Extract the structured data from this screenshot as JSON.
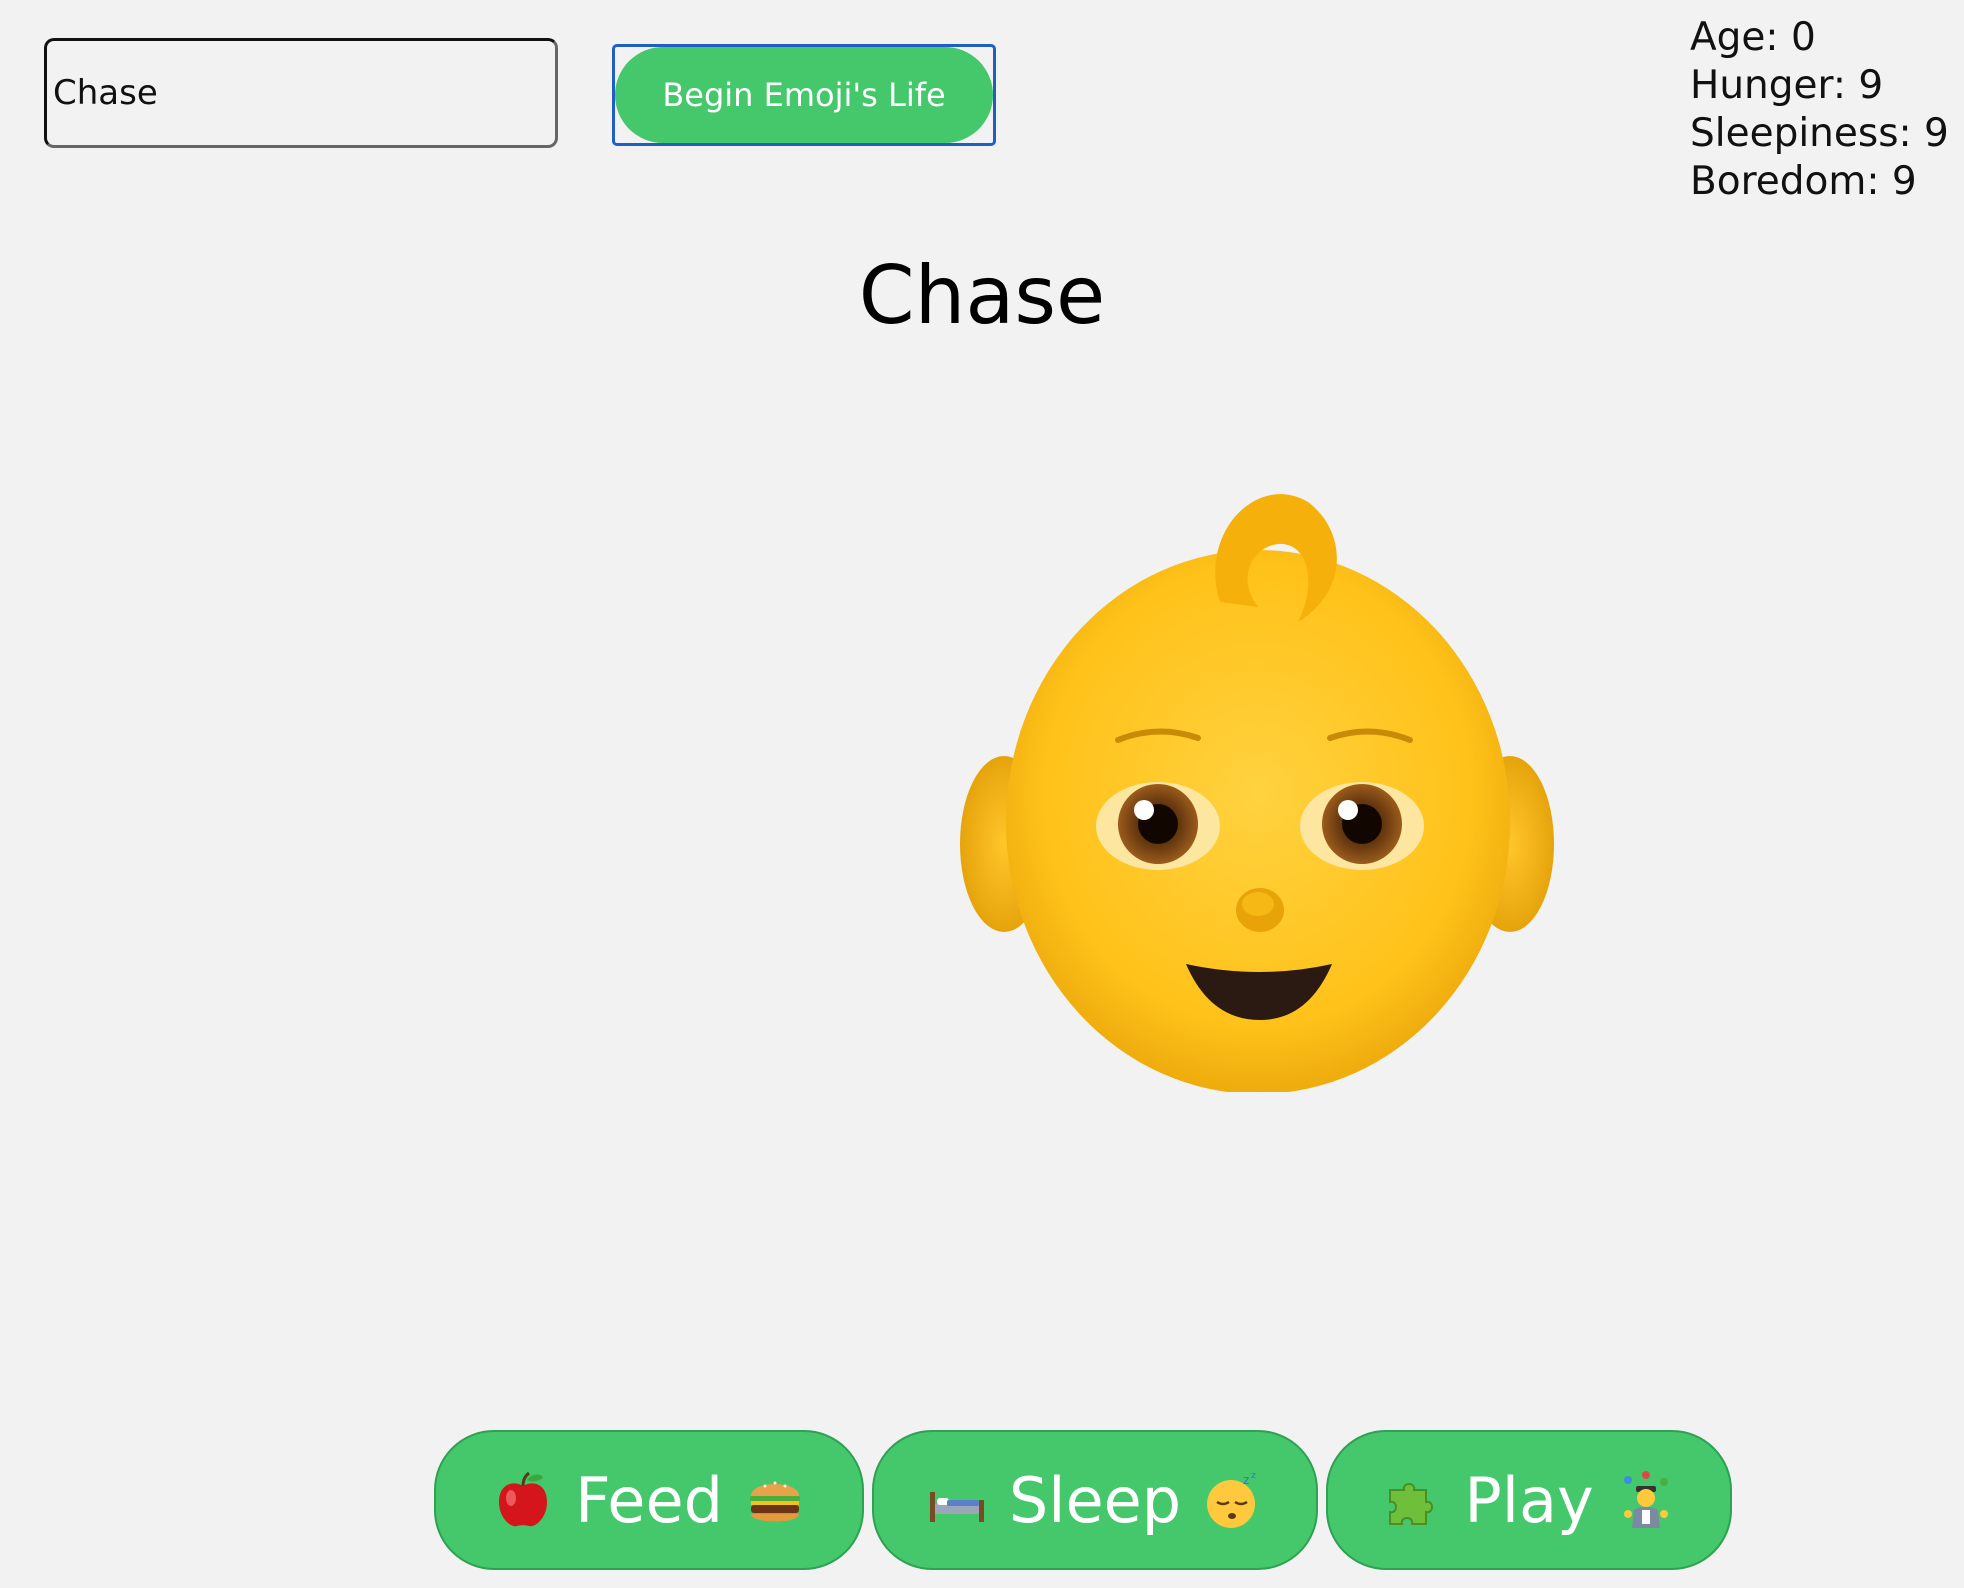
{
  "controls": {
    "name_input_value": "Chase",
    "begin_button_label": "Begin Emoji's Life"
  },
  "stats": {
    "age": "Age: 0",
    "hunger": "Hunger: 9",
    "sleepiness": "Sleepiness: 9",
    "boredom": "Boredom: 9"
  },
  "pet": {
    "name": "Chase",
    "emoji_icon": "baby-face-icon"
  },
  "actions": {
    "feed": {
      "label": "Feed",
      "left_icon": "red-apple-icon",
      "right_icon": "hamburger-icon"
    },
    "sleep": {
      "label": "Sleep",
      "left_icon": "bed-icon",
      "right_icon": "sleeping-face-icon"
    },
    "play": {
      "label": "Play",
      "left_icon": "puzzle-piece-icon",
      "right_icon": "juggler-icon"
    }
  },
  "colors": {
    "background": "#f2f2f2",
    "button_green": "#45c76b",
    "focus_outline": "#1f5fc4",
    "emoji_yellow": "#ffc83d"
  }
}
